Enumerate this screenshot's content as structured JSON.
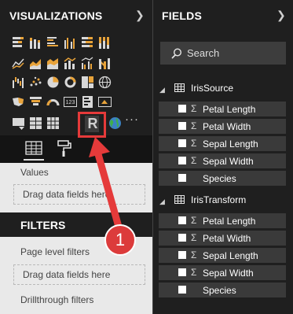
{
  "visualizations": {
    "title": "VISUALIZATIONS",
    "expand_icon": "chevron-right-icon",
    "icons": [
      "stacked-bar-chart-icon",
      "stacked-column-chart-icon",
      "clustered-bar-chart-icon",
      "clustered-column-chart-icon",
      "100pct-stacked-bar-chart-icon",
      "100pct-stacked-column-chart-icon",
      "line-chart-icon",
      "area-chart-icon",
      "stacked-area-chart-icon",
      "line-and-column-chart-icon",
      "line-and-clustered-column-chart-icon",
      "ribbon-chart-icon",
      "waterfall-chart-icon",
      "scatter-chart-icon",
      "pie-chart-icon",
      "donut-chart-icon",
      "treemap-icon",
      "map-icon",
      "filled-map-icon",
      "funnel-icon",
      "gauge-icon",
      "card-icon",
      "multi-row-card-icon",
      "kpi-icon",
      "slicer-icon",
      "table-icon",
      "matrix-icon",
      "r-visual-icon",
      "globe-map-icon",
      "more-visuals-icon"
    ],
    "r_label": "R",
    "more_label": "···",
    "tabs": [
      "fields-tab-icon",
      "format-paint-roller-icon"
    ],
    "values_label": "Values",
    "values_drop": "Drag data fields here"
  },
  "filters": {
    "title": "FILTERS",
    "page_level_label": "Page level filters",
    "page_drop": "Drag data fields here",
    "drillthrough_label": "Drillthrough filters"
  },
  "fields": {
    "title": "FIELDS",
    "expand_icon": "chevron-right-icon",
    "search_placeholder": "Search",
    "sigma": "Σ",
    "tables": [
      {
        "name": "IrisSource",
        "fields": [
          {
            "name": "Petal Length",
            "sigma": true
          },
          {
            "name": "Petal Width",
            "sigma": true
          },
          {
            "name": "Sepal Length",
            "sigma": true
          },
          {
            "name": "Sepal Width",
            "sigma": true
          },
          {
            "name": "Species",
            "sigma": false
          }
        ]
      },
      {
        "name": "IrisTransform",
        "fields": [
          {
            "name": "Petal Length",
            "sigma": true
          },
          {
            "name": "Petal Width",
            "sigma": true
          },
          {
            "name": "Sepal Length",
            "sigma": true
          },
          {
            "name": "Sepal Width",
            "sigma": true
          },
          {
            "name": "Species",
            "sigma": false
          }
        ]
      }
    ]
  },
  "annotation": {
    "number": "1",
    "color": "#dc3b3b"
  }
}
